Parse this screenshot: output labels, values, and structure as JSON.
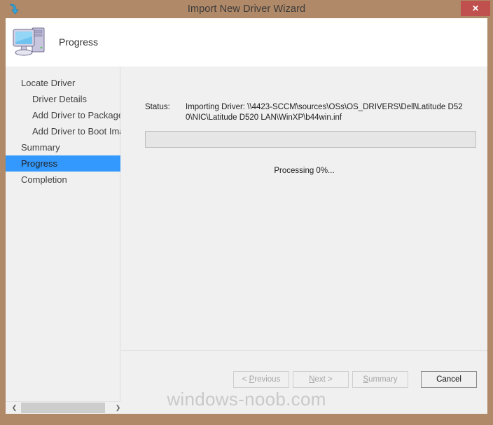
{
  "window": {
    "title": "Import New Driver Wizard",
    "title_icon": "import-arrow-icon",
    "close_label": "✕",
    "frame_color": "#b08968",
    "close_button_color": "#c0504d"
  },
  "header": {
    "icon": "computer-icon",
    "title": "Progress"
  },
  "sidebar": {
    "items": [
      {
        "label": "Locate Driver",
        "level": 0,
        "selected": false
      },
      {
        "label": "Driver Details",
        "level": 1,
        "selected": false
      },
      {
        "label": "Add Driver to Packages",
        "level": 1,
        "selected": false
      },
      {
        "label": "Add Driver to Boot Image",
        "level": 1,
        "selected": false
      },
      {
        "label": "Summary",
        "level": 0,
        "selected": false
      },
      {
        "label": "Progress",
        "level": 0,
        "selected": true
      },
      {
        "label": "Completion",
        "level": 0,
        "selected": false
      }
    ],
    "selection_color": "#3399ff",
    "scrollbar": {
      "left_arrow": "❮",
      "right_arrow": "❯"
    }
  },
  "main": {
    "status_label": "Status:",
    "status_value": "Importing Driver: \\\\4423-SCCM\\sources\\OSs\\OS_DRIVERS\\Dell\\Latitude D520\\NIC\\Latitude D520 LAN\\WinXP\\b44win.inf",
    "progress_percent": 0,
    "processing_text": "Processing 0%..."
  },
  "buttons": {
    "previous": {
      "prefix": "< ",
      "accel": "P",
      "rest": "revious",
      "enabled": false
    },
    "next": {
      "prefix": "",
      "accel": "N",
      "rest": "ext >",
      "enabled": false
    },
    "summary": {
      "prefix": "",
      "accel": "S",
      "rest": "ummary",
      "enabled": false
    },
    "cancel": {
      "label": "Cancel",
      "enabled": true
    }
  },
  "watermark": "windows-noob.com"
}
